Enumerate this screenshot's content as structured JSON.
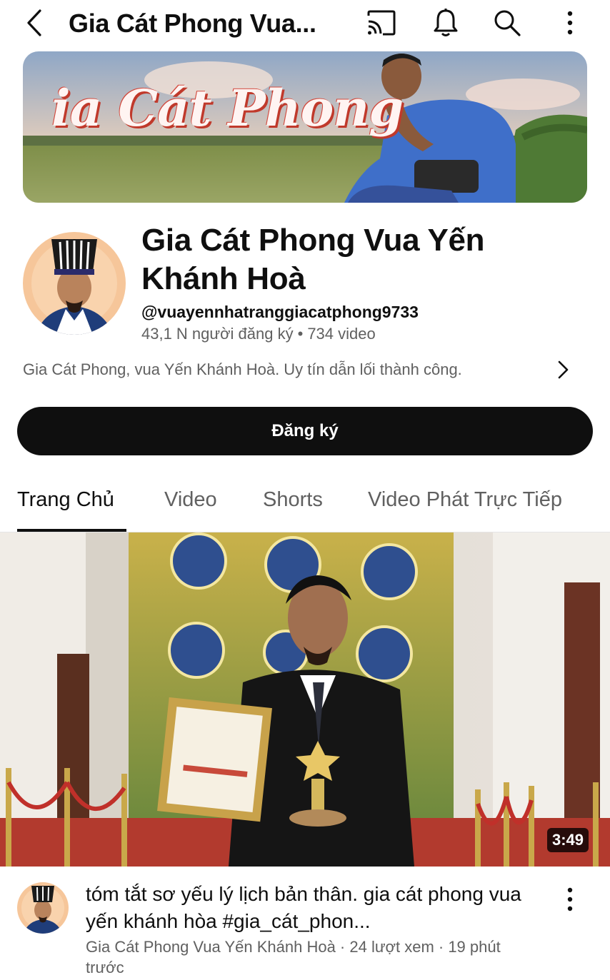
{
  "header": {
    "title": "Gia Cát Phong Vua...",
    "icons": [
      "back-arrow-icon",
      "cast-icon",
      "bell-icon",
      "search-icon",
      "more-vertical-icon"
    ]
  },
  "banner": {
    "text": "ia Cát Phong"
  },
  "channel": {
    "name": "Gia Cát Phong Vua Yến Khánh Hoà",
    "handle": "@vuayennhatranggiacatphong9733",
    "subscribers": "43,1 N người đăng ký",
    "video_count": "734 video",
    "separator": "•",
    "description": "Gia Cát Phong, vua Yến Khánh Hoà. Uy tín dẫn lối thành công."
  },
  "subscribe": {
    "label": "Đăng ký"
  },
  "tabs": [
    {
      "label": "Trang Chủ",
      "active": true
    },
    {
      "label": "Video",
      "active": false
    },
    {
      "label": "Shorts",
      "active": false
    },
    {
      "label": "Video Phát Trực Tiếp",
      "active": false
    }
  ],
  "video": {
    "duration": "3:49",
    "title": "tóm tắt sơ yếu lý lịch bản thân. gia cát phong vua yến khánh hòa #gia_cát_phon...",
    "meta": "Gia Cát Phong Vua Yến Khánh Hoà · 24 lượt xem · 19 phút trước"
  },
  "colors": {
    "text_primary": "#0f0f0f",
    "text_secondary": "#606060",
    "button_dark": "#0f0f0f",
    "banner_text_shadow": "#c0392b"
  }
}
